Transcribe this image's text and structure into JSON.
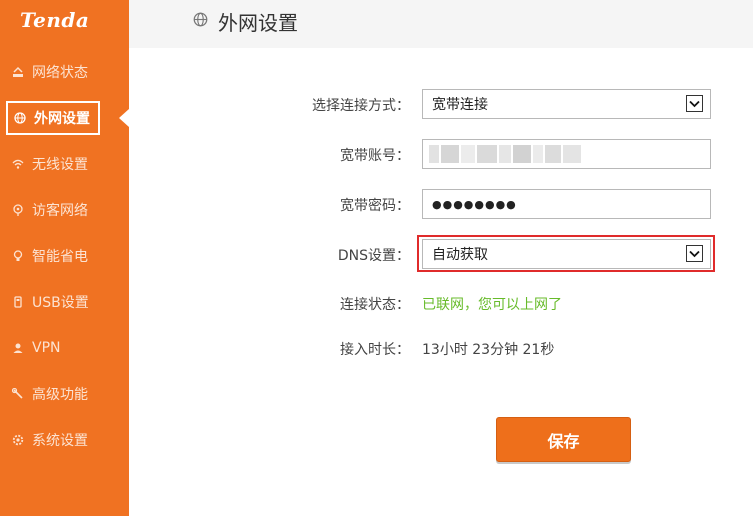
{
  "brand": "Tenda",
  "colors": {
    "sidebar": "#f07222",
    "accent": "#ee6f1b",
    "status_ok": "#67bb2a",
    "highlight": "#e02b2b"
  },
  "sidebar": {
    "items": [
      {
        "label": "网络状态",
        "icon": "network-status-icon"
      },
      {
        "label": "外网设置",
        "icon": "globe-icon",
        "active": true
      },
      {
        "label": "无线设置",
        "icon": "wifi-icon"
      },
      {
        "label": "访客网络",
        "icon": "guest-icon"
      },
      {
        "label": "智能省电",
        "icon": "bulb-icon"
      },
      {
        "label": "USB设置",
        "icon": "usb-icon"
      },
      {
        "label": "VPN",
        "icon": "vpn-icon"
      },
      {
        "label": "高级功能",
        "icon": "wrench-icon"
      },
      {
        "label": "系统设置",
        "icon": "gear-icon"
      }
    ]
  },
  "header": {
    "title": "外网设置",
    "icon": "globe-icon"
  },
  "form": {
    "connection_type": {
      "label": "选择连接方式：",
      "value": "宽带连接"
    },
    "account": {
      "label": "宽带账号：",
      "value": ""
    },
    "password": {
      "label": "宽带密码：",
      "value": "●●●●●●●●"
    },
    "dns": {
      "label": "DNS设置：",
      "value": "自动获取"
    },
    "status": {
      "label": "连接状态：",
      "value": "已联网，您可以上网了"
    },
    "duration": {
      "label": "接入时长：",
      "value": "13小时 23分钟 21秒"
    }
  },
  "save_label": "保存"
}
